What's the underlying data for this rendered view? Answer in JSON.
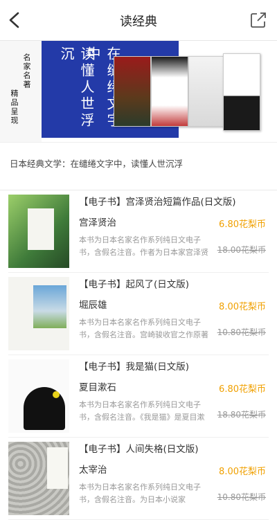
{
  "header": {
    "title": "读经典",
    "back_icon": "chevron-left-icon",
    "share_icon": "share-icon"
  },
  "banner": {
    "left_text_1": "名家名著",
    "left_text_2": "精品呈现",
    "main_col_1": "读懂人世浮沉",
    "main_col_2": "在缱绻文字中",
    "colors": {
      "blue": "#233aa8",
      "accent": "#f0a000"
    }
  },
  "section": {
    "description": "日本经典文学：在缱绻文字中，读懂人世沉浮"
  },
  "books": [
    {
      "title": "【电子书】宫泽贤治短篇作品(日文版)",
      "author": "宫泽贤治",
      "summary": "本书为日本名家名作系列纯日文电子书，含假名注音。作者为日本家宫泽贤治，他是日本家喻户晓",
      "price": "6.80花梨币",
      "original_price": "18.00花梨币"
    },
    {
      "title": "【电子书】起风了(日文版)",
      "author": "堀辰雄",
      "summary": "本书为日本名家名作系列纯日文电子书，含假名注音。宫崎骏收官之作原著小说，讲述未婚妻节子身",
      "price": "8.00花梨币",
      "original_price": "10.80花梨币"
    },
    {
      "title": "【电子书】我是猫(日文版)",
      "author": "夏目漱石",
      "summary": "本书为日本名家名作系列纯日文电子书，含假名注音。《我是猫》是夏目漱石作为批判现实主义小说",
      "price": "6.80花梨币",
      "original_price": "18.80花梨币"
    },
    {
      "title": "【电子书】人间失格(日文版)",
      "author": "太宰治",
      "summary": "本书为日本名家名作系列纯日文电子书，含假名注音。为日本小说家",
      "price": "8.00花梨币",
      "original_price": "10.80花梨币"
    }
  ]
}
